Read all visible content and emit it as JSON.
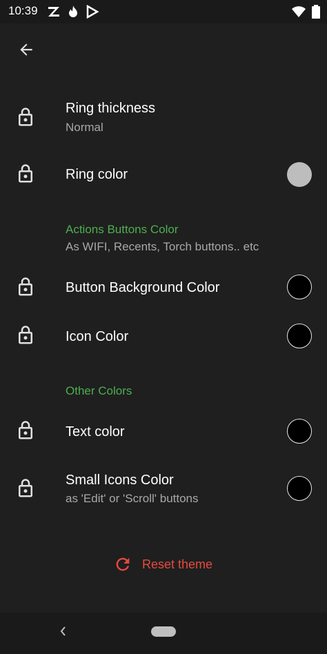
{
  "status_bar": {
    "time": "10:39",
    "left_icons": [
      "z-app-icon",
      "fire-app-icon",
      "play-app-icon"
    ],
    "right_icons": [
      "wifi-icon",
      "battery-icon"
    ]
  },
  "toolbar": {
    "back_icon": "arrow-left-icon"
  },
  "settings": {
    "ring_thickness": {
      "title": "Ring thickness",
      "subtitle": "Normal"
    },
    "ring_color": {
      "title": "Ring color",
      "swatch": "#bdbdbd"
    },
    "actions_section": {
      "title": "Actions Buttons Color",
      "subtitle": "As WIFI, Recents, Torch buttons.. etc"
    },
    "button_bg_color": {
      "title": "Button Background Color",
      "swatch": "#000000"
    },
    "icon_color": {
      "title": "Icon Color",
      "swatch": "#000000"
    },
    "other_section": {
      "title": "Other Colors"
    },
    "text_color": {
      "title": "Text color",
      "swatch": "#000000"
    },
    "small_icons_color": {
      "title": "Small Icons Color",
      "subtitle": "as 'Edit' or 'Scroll' buttons",
      "swatch": "#000000"
    }
  },
  "reset": {
    "label": "Reset theme",
    "icon": "refresh-icon",
    "color": "#e84a3c"
  },
  "colors": {
    "accent_green": "#4caf50",
    "background": "#1f1f1f"
  }
}
